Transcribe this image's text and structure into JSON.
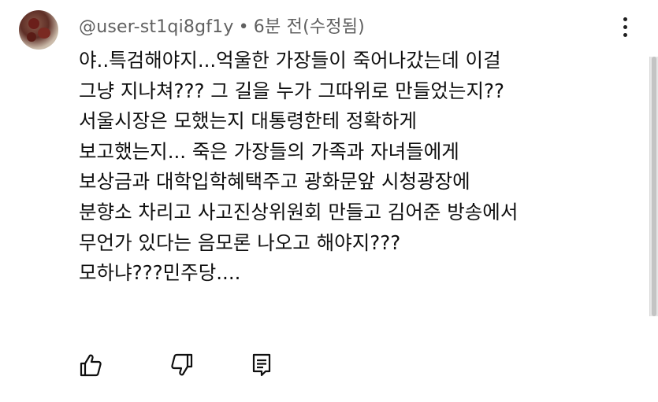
{
  "comment": {
    "author": "@user-st1qi8gf1y",
    "separator": "•",
    "time": "6분 전(수정됨)",
    "lines": [
      "야..특검해야지...억울한 가장들이 죽어나갔는데 이걸",
      "그냥 지나쳐??? 그 길을 누가 그따위로 만들었는지??",
      "서울시장은 모했는지 대통령한테 정확하게",
      "보고했는지... 죽은 가장들의 가족과 자녀들에게",
      "보상금과 대학입학혜택주고 광화문앞 시청광장에",
      "분향소 차리고 사고진상위원회 만들고 김어준 방송에서",
      "무언가 있다는 음모론 나오고 해야지???",
      "모하냐???민주당...."
    ]
  },
  "icons": {
    "avatar": "avatar-image",
    "menu": "more-vertical-icon",
    "like": "thumbs-up-icon",
    "dislike": "thumbs-down-icon",
    "reply": "reply-comment-icon"
  },
  "colors": {
    "text": "#0f0f0f",
    "meta": "#606060"
  }
}
